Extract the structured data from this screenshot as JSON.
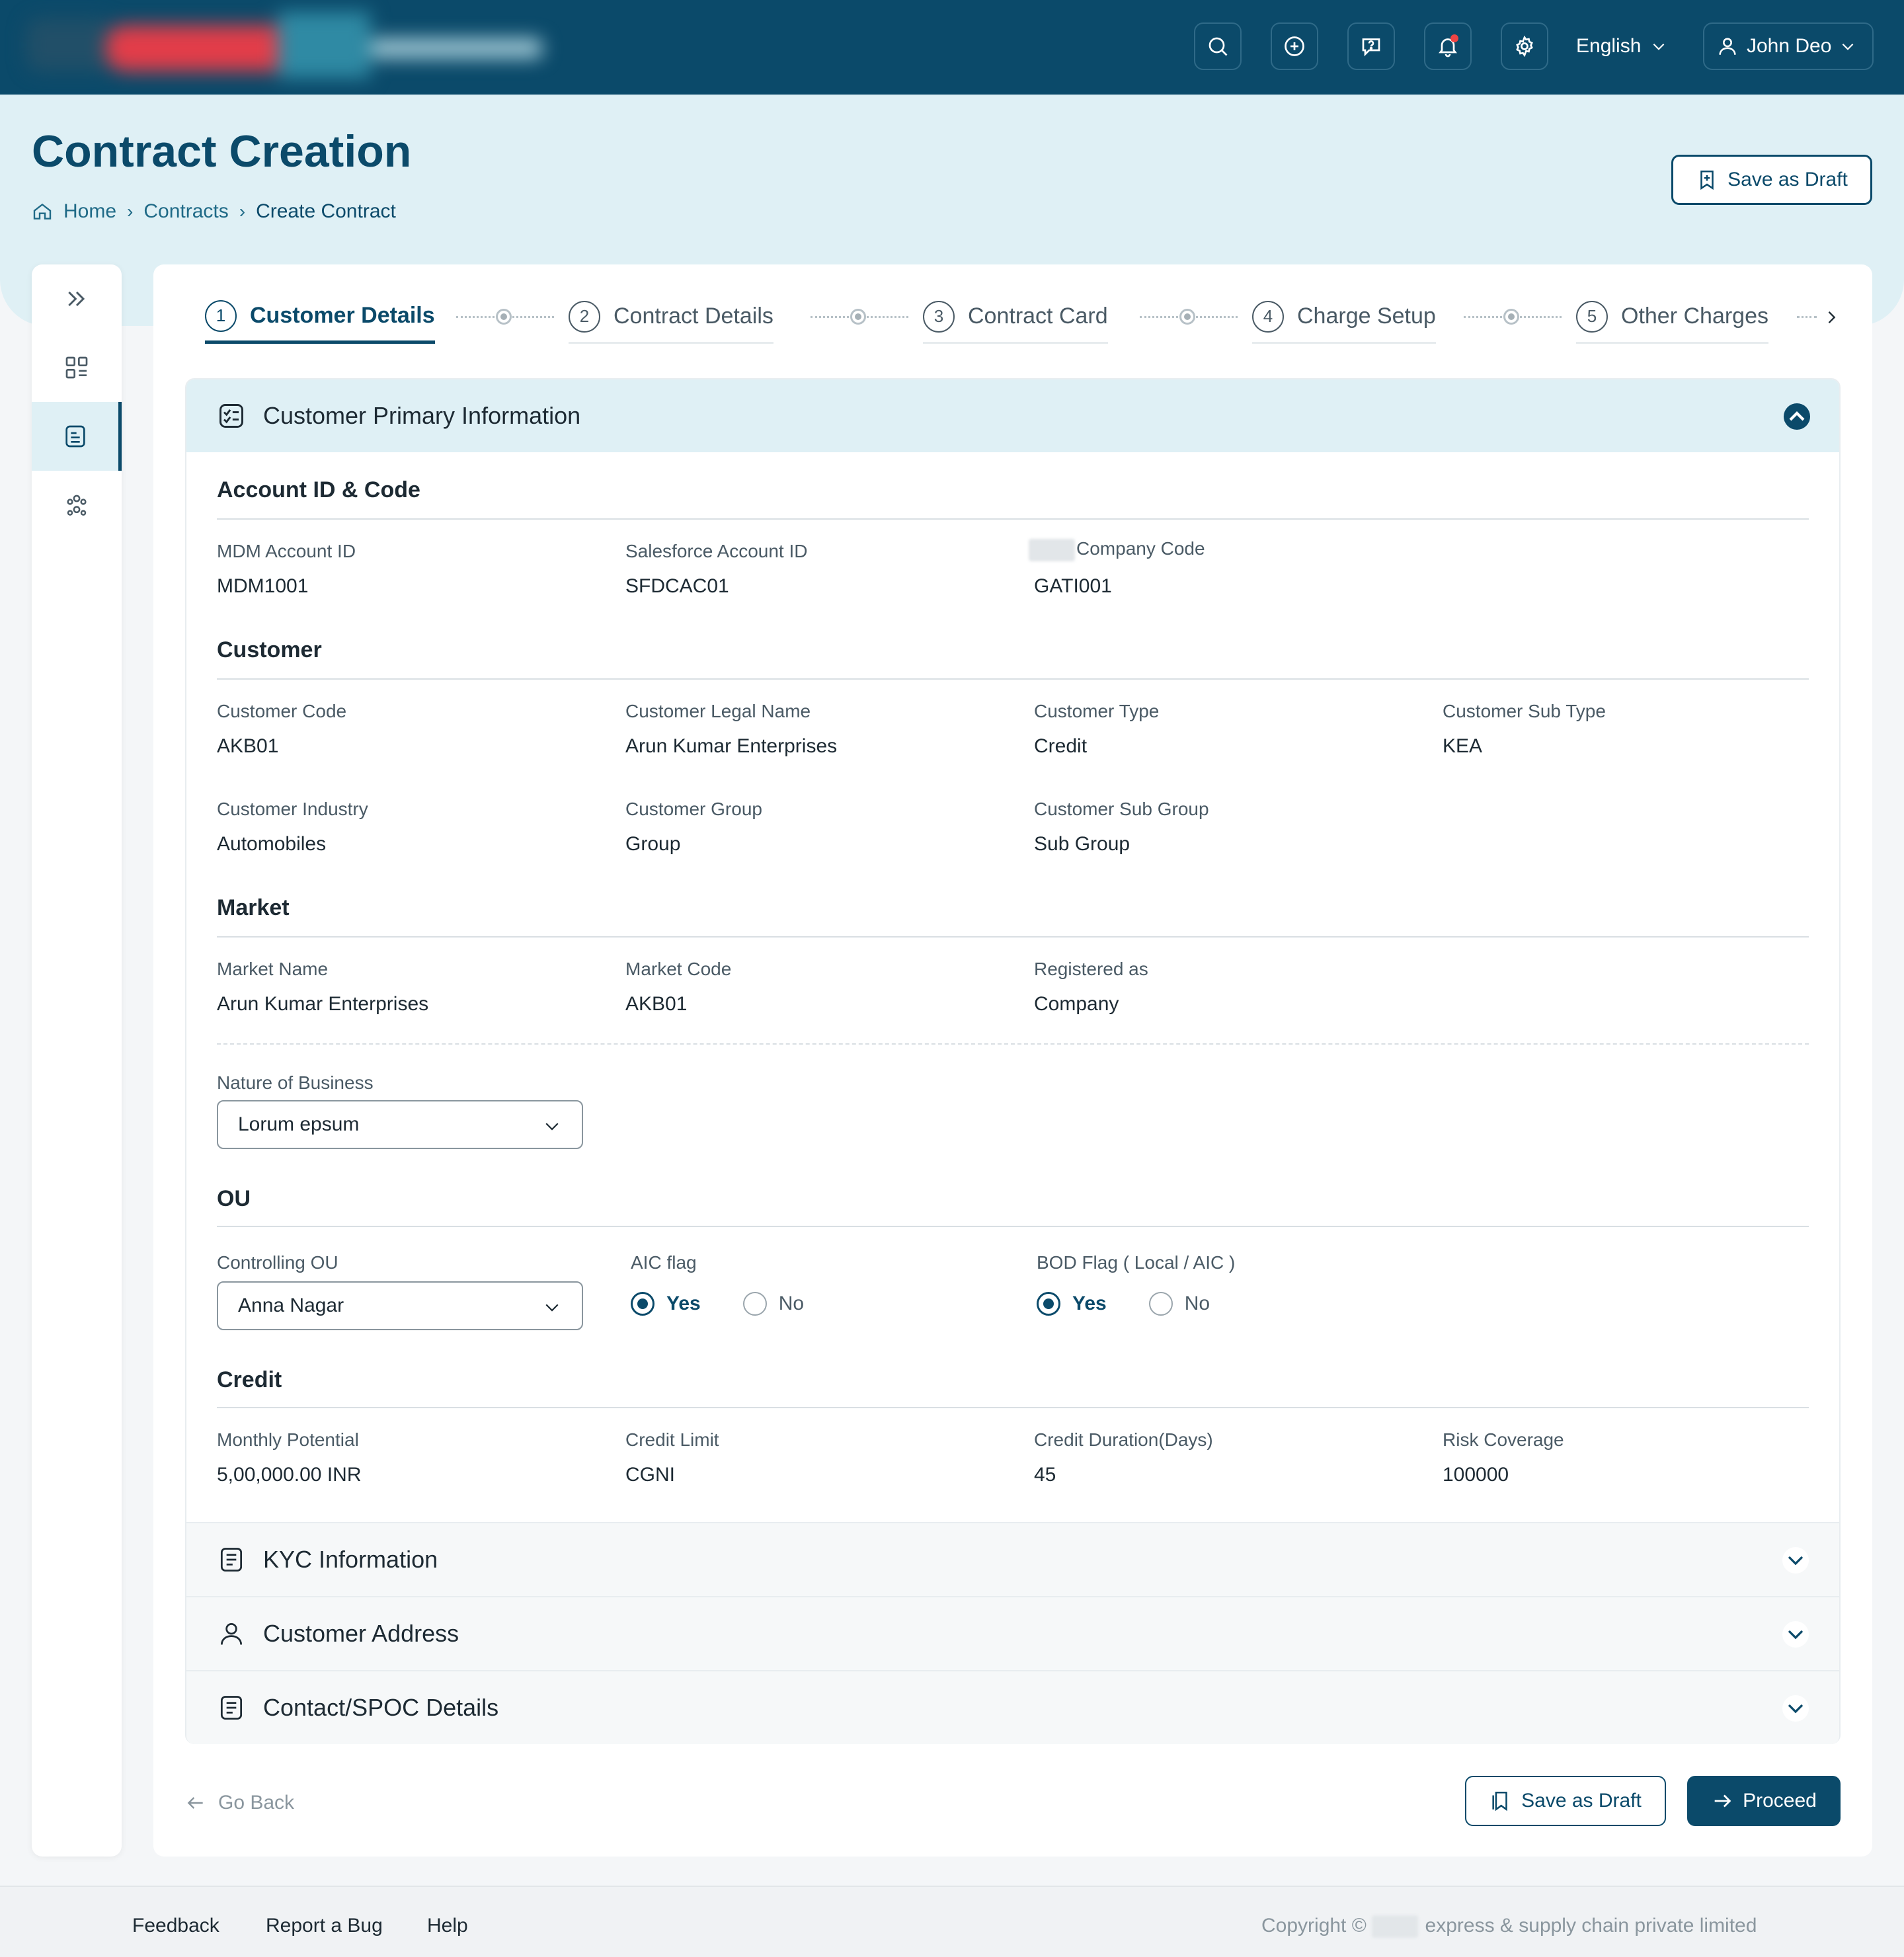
{
  "colors": {
    "primary": "#0b4a6a",
    "hero_bg": "#dff0f5",
    "accent_red": "#ef4444"
  },
  "topbar": {
    "icons": [
      "search-icon",
      "plus-circle-icon",
      "chat-question-icon",
      "bell-icon",
      "gear-icon"
    ],
    "language": "English",
    "user_name": "John Deo"
  },
  "header": {
    "title": "Contract Creation",
    "breadcrumb": [
      "Home",
      "Contracts",
      "Create Contract"
    ],
    "save_draft": "Save as Draft"
  },
  "sidebar": {
    "items": [
      "expand-icon",
      "dashboard-icon",
      "contract-doc-icon",
      "users-group-icon"
    ],
    "active_index": 2
  },
  "stepper": {
    "steps": [
      {
        "num": "1",
        "label": "Customer Details"
      },
      {
        "num": "2",
        "label": "Contract  Details"
      },
      {
        "num": "3",
        "label": "Contract Card"
      },
      {
        "num": "4",
        "label": "Charge Setup"
      },
      {
        "num": "5",
        "label": "Other Charges"
      }
    ],
    "active_index": 0
  },
  "primary_info": {
    "title": "Customer Primary Information",
    "account": {
      "heading": "Account ID & Code",
      "fields": [
        {
          "label": "MDM Account ID",
          "value": "MDM1001"
        },
        {
          "label": "Salesforce Account ID",
          "value": "SFDCAC01"
        },
        {
          "label": "Company  Code",
          "value": "GATI001"
        }
      ]
    },
    "customer": {
      "heading": "Customer",
      "fields": [
        {
          "label": "Customer Code",
          "value": "AKB01"
        },
        {
          "label": "Customer Legal Name",
          "value": "Arun Kumar Enterprises"
        },
        {
          "label": "Customer Type",
          "value": "Credit"
        },
        {
          "label": "Customer Sub Type",
          "value": "KEA"
        },
        {
          "label": "Customer Industry",
          "value": "Automobiles"
        },
        {
          "label": "Customer Group",
          "value": "Group"
        },
        {
          "label": "Customer Sub Group",
          "value": "Sub Group"
        }
      ]
    },
    "market": {
      "heading": "Market",
      "fields": [
        {
          "label": "Market Name",
          "value": "Arun Kumar Enterprises"
        },
        {
          "label": "Market Code",
          "value": "AKB01"
        },
        {
          "label": "Registered as",
          "value": "Company"
        }
      ],
      "nature_label": "Nature of Business",
      "nature_value": "Lorum epsum"
    },
    "ou": {
      "heading": "OU",
      "controlling_label": "Controlling OU",
      "controlling_value": "Anna Nagar",
      "aic_label": "AIC flag",
      "bod_label": "BOD Flag ( Local / AIC )",
      "yes": "Yes",
      "no": "No"
    },
    "credit": {
      "heading": "Credit",
      "fields": [
        {
          "label": "Monthly Potential",
          "value": "5,00,000.00 INR"
        },
        {
          "label": "Credit Limit",
          "value": "CGNI"
        },
        {
          "label": "Credit Duration(Days)",
          "value": "45"
        },
        {
          "label": "Risk Coverage",
          "value": "100000"
        }
      ]
    }
  },
  "collapsed_sections": [
    "KYC Information",
    "Customer Address",
    "Contact/SPOC Details"
  ],
  "actions": {
    "go_back": "Go Back",
    "save_draft": "Save as Draft",
    "proceed": "Proceed"
  },
  "footer": {
    "links": [
      "Feedback",
      "Report a Bug",
      "Help"
    ],
    "copyright_prefix": "Copyright ©",
    "copyright_suffix": "express & supply chain private limited"
  }
}
